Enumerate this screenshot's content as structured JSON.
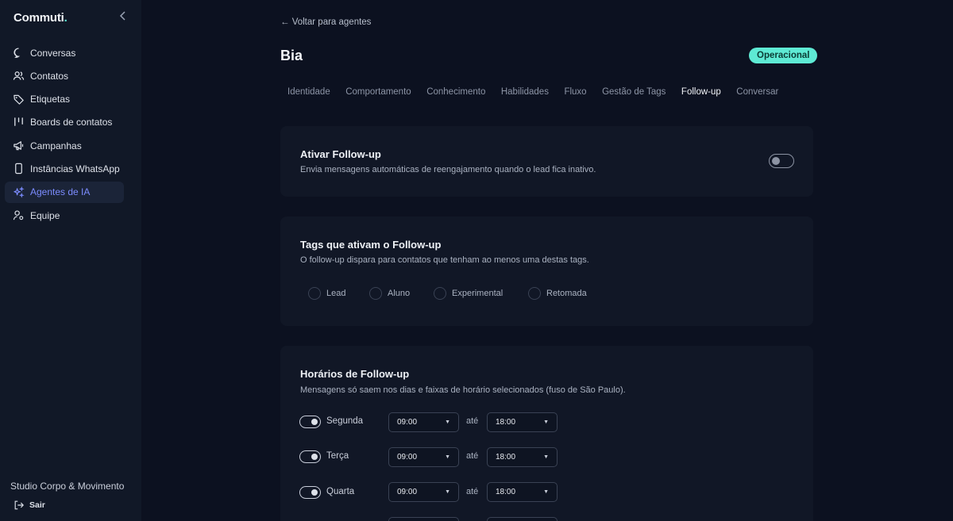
{
  "sidebar": {
    "logo": "Commuti",
    "logo_dot": ".",
    "items": [
      {
        "label": "Conversas",
        "icon": "chat-bubble-icon"
      },
      {
        "label": "Contatos",
        "icon": "users-icon"
      },
      {
        "label": "Etiquetas",
        "icon": "tag-icon"
      },
      {
        "label": "Boards de contatos",
        "icon": "kanban-icon"
      },
      {
        "label": "Campanhas",
        "icon": "megaphone-icon"
      },
      {
        "label": "Instâncias WhatsApp",
        "icon": "phone-icon"
      },
      {
        "label": "Agentes de IA",
        "icon": "sparkles-icon",
        "active": true
      },
      {
        "label": "Equipe",
        "icon": "user-cog-icon"
      }
    ],
    "workspace": "Studio Corpo & Movimento",
    "logout": "Sair"
  },
  "header": {
    "back_link": "← Voltar para agentes",
    "agent_name": "Bia",
    "status": "Operacional"
  },
  "tabs": [
    "Identidade",
    "Comportamento",
    "Conhecimento",
    "Habilidades",
    "Fluxo",
    "Gestão de Tags",
    "Follow-up",
    "Conversar"
  ],
  "active_tab": "Follow-up",
  "followup": {
    "title": "Ativar Follow-up",
    "description": "Envia mensagens automáticas de reengajamento quando o lead fica inativo.",
    "enabled": false
  },
  "tags_card": {
    "title": "Tags que ativam o Follow-up",
    "description": "O follow-up dispara para contatos que tenham ao menos uma destas tags.",
    "tags": [
      "Lead",
      "Aluno",
      "Experimental",
      "Retomada"
    ]
  },
  "schedule": {
    "title": "Horários de Follow-up",
    "description": "Mensagens só saem nos dias e faixas de horário selecionados (fuso de São Paulo).",
    "separator": "até",
    "days": [
      {
        "day": "Segunda",
        "start": "09:00",
        "end": "18:00",
        "enabled": true
      },
      {
        "day": "Terça",
        "start": "09:00",
        "end": "18:00",
        "enabled": true
      },
      {
        "day": "Quarta",
        "start": "09:00",
        "end": "18:00",
        "enabled": true
      }
    ]
  },
  "colors": {
    "background": "#0c1120",
    "sidebar": "#111827",
    "card": "#111726",
    "accent": "#7c8cff",
    "status": "#5eead4"
  }
}
